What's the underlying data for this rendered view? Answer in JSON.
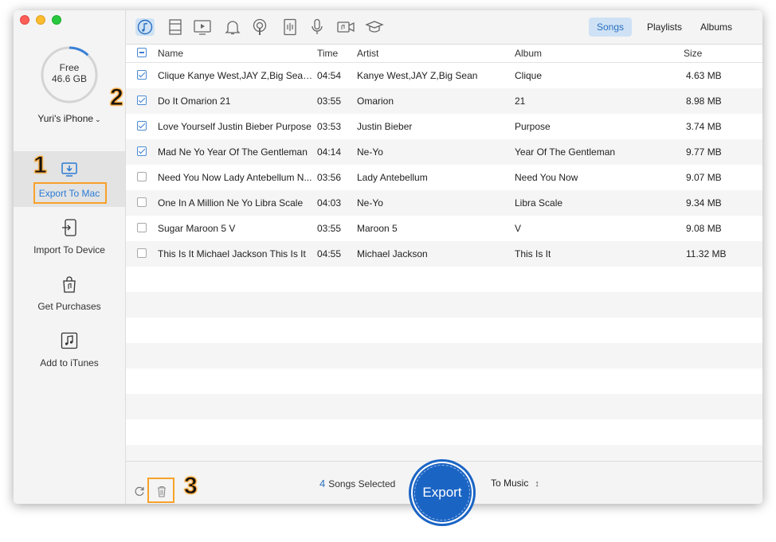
{
  "sidebar": {
    "storage": {
      "label": "Free",
      "value": "46.6 GB",
      "used_fraction": 0.12
    },
    "device_name": "Yuri's iPhone",
    "items": [
      {
        "label": "Export To Mac",
        "icon": "export-to-mac-icon",
        "active": true
      },
      {
        "label": "Import To Device",
        "icon": "import-to-device-icon",
        "active": false
      },
      {
        "label": "Get Purchases",
        "icon": "shopping-bag-icon",
        "active": false
      },
      {
        "label": "Add to iTunes",
        "icon": "music-note-icon",
        "active": false
      }
    ]
  },
  "toolbar": {
    "categories": [
      "music-icon",
      "movies-icon",
      "tv-shows-icon",
      "ringtones-icon",
      "podcasts-icon",
      "audiobooks-icon",
      "voice-memos-icon",
      "videos-icon",
      "itunes-u-icon"
    ],
    "views": [
      "Songs",
      "Playlists",
      "Albums"
    ]
  },
  "table": {
    "headers": {
      "name": "Name",
      "time": "Time",
      "artist": "Artist",
      "album": "Album",
      "size": "Size"
    },
    "rows": [
      {
        "checked": true,
        "name": "Clique Kanye West,JAY Z,Big Sean...",
        "time": "04:54",
        "artist": "Kanye West,JAY Z,Big Sean",
        "album": "Clique",
        "size": "4.63 MB"
      },
      {
        "checked": true,
        "name": "Do It Omarion 21",
        "time": "03:55",
        "artist": "Omarion",
        "album": "21",
        "size": "8.98 MB"
      },
      {
        "checked": true,
        "name": "Love Yourself Justin Bieber Purpose",
        "time": "03:53",
        "artist": "Justin Bieber",
        "album": "Purpose",
        "size": "3.74 MB"
      },
      {
        "checked": true,
        "name": "Mad Ne Yo Year Of The Gentleman",
        "time": "04:14",
        "artist": "Ne-Yo",
        "album": "Year Of The Gentleman",
        "size": "9.77 MB"
      },
      {
        "checked": false,
        "name": "Need You Now Lady Antebellum N...",
        "time": "03:56",
        "artist": "Lady Antebellum",
        "album": "Need You Now",
        "size": "9.07 MB"
      },
      {
        "checked": false,
        "name": "One In A Million Ne Yo Libra Scale",
        "time": "04:03",
        "artist": "Ne-Yo",
        "album": "Libra Scale",
        "size": "9.34 MB"
      },
      {
        "checked": false,
        "name": "Sugar Maroon 5 V",
        "time": "03:55",
        "artist": "Maroon 5",
        "album": "V",
        "size": "9.08 MB"
      },
      {
        "checked": false,
        "name": "This Is It Michael Jackson This Is It",
        "time": "04:55",
        "artist": "Michael Jackson",
        "album": "This Is It",
        "size": "11.32 MB"
      }
    ]
  },
  "footer": {
    "selected_count": "4",
    "selected_label": "Songs Selected",
    "export_label": "Export",
    "destination": "To Music"
  },
  "callouts": [
    "1",
    "2",
    "3"
  ],
  "colors": {
    "accent": "#1a64c4",
    "callout": "#f7a12a",
    "active_tab_bg": "#cfe2f5"
  }
}
